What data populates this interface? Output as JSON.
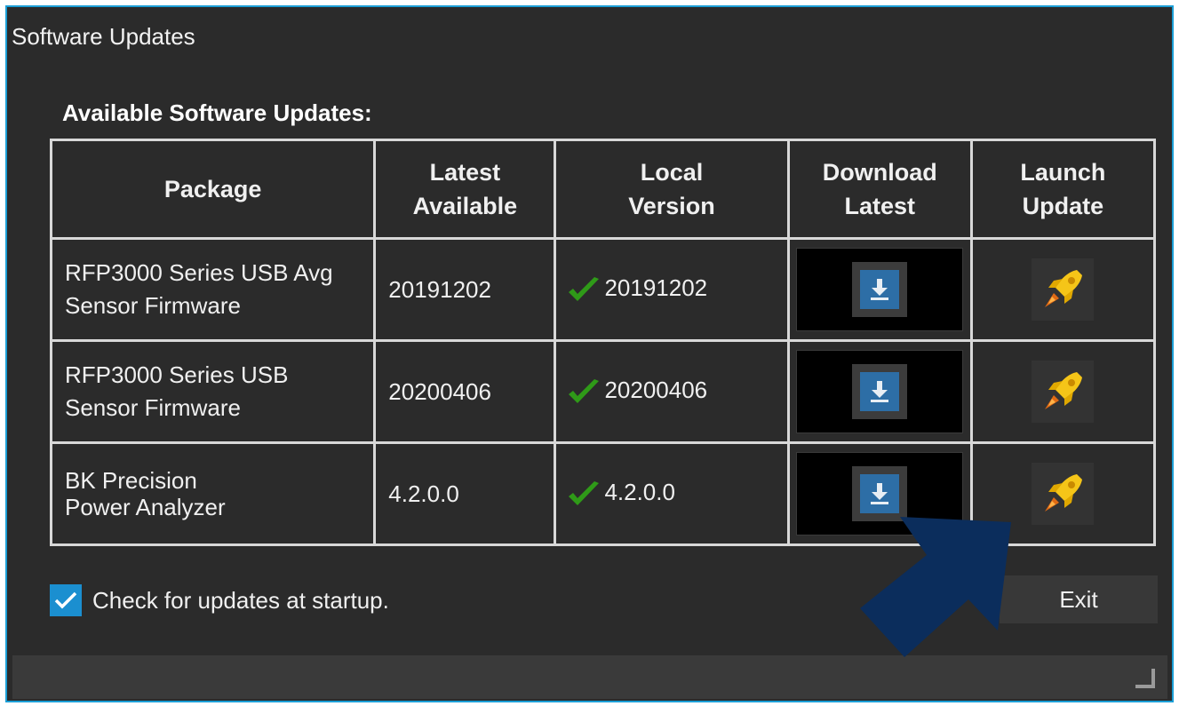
{
  "window": {
    "title": "Software Updates",
    "accent_color": "#1b9ed6",
    "background_color": "#2b2b2b"
  },
  "updates": {
    "heading": "Available Software Updates:",
    "columns": {
      "package": "Package",
      "latest": "Latest Available",
      "local": "Local Version",
      "download": "Download Latest",
      "launch": "Launch Update"
    },
    "rows": [
      {
        "package_line1": "RFP3000 Series USB Avg",
        "package_line2": "Sensor Firmware",
        "latest": "20191202",
        "local": "20191202",
        "status_icon": "check-icon",
        "download_icon": "download-icon",
        "launch_icon": "rocket-icon"
      },
      {
        "package_line1": "RFP3000 Series USB",
        "package_line2": "Sensor Firmware",
        "latest": "20200406",
        "local": "20200406",
        "status_icon": "check-icon",
        "download_icon": "download-icon",
        "launch_icon": "rocket-icon"
      },
      {
        "package_line1": "BK Precision",
        "package_line2": "Power Analyzer",
        "latest": "4.2.0.0",
        "local": "4.2.0.0",
        "status_icon": "check-icon",
        "download_icon": "download-icon",
        "launch_icon": "rocket-icon"
      }
    ]
  },
  "footer": {
    "check_startup_label": "Check for updates at startup.",
    "check_startup_checked": true,
    "exit_label": "Exit"
  },
  "annotation": {
    "arrow_color": "#0b2d5c"
  }
}
